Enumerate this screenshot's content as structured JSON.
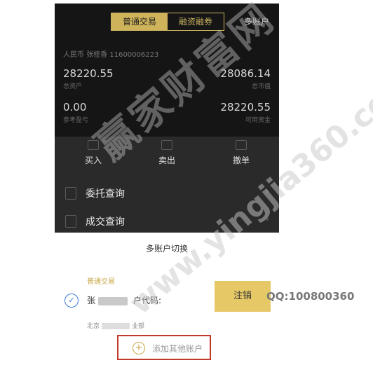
{
  "header": {
    "tabs": [
      {
        "label": "普通交易",
        "active": true
      },
      {
        "label": "融资融券",
        "active": false
      }
    ],
    "multi_account": "多账户"
  },
  "account": {
    "info": "人民币 张桂香 11600006223",
    "total_assets_value": "28220.55",
    "total_assets_label": "总资产",
    "market_value": "28086.14",
    "market_value_label": "总市值",
    "pnl_value": "0.00",
    "pnl_label": "参考盈亏",
    "available_value": "28220.55",
    "available_label": "可用资金"
  },
  "actions": [
    {
      "label": "买入",
      "icon": "buy-icon"
    },
    {
      "label": "卖出",
      "icon": "sell-icon"
    },
    {
      "label": "撤单",
      "icon": "cancel-order-icon"
    }
  ],
  "menu": [
    {
      "label": "委托查询",
      "icon": "order-query-icon"
    },
    {
      "label": "成交查询",
      "icon": "trade-query-icon"
    }
  ],
  "sheet": {
    "title": "多账户切换",
    "section": "普通交易",
    "account_prefix": "张",
    "account_code_label": "户代码:",
    "branch_prefix": "北京",
    "branch_suffix": "业部",
    "cancel": "注销",
    "add": "添加其他账户"
  },
  "watermark": {
    "main": "赢家财富网",
    "url": "www.yingjia360.com",
    "qq": "QQ:100800360"
  },
  "colors": {
    "accent": "#cfb35b",
    "dark_bg": "#151515",
    "cancel_bg": "#e6c866",
    "highlight_border": "#c0392b"
  }
}
